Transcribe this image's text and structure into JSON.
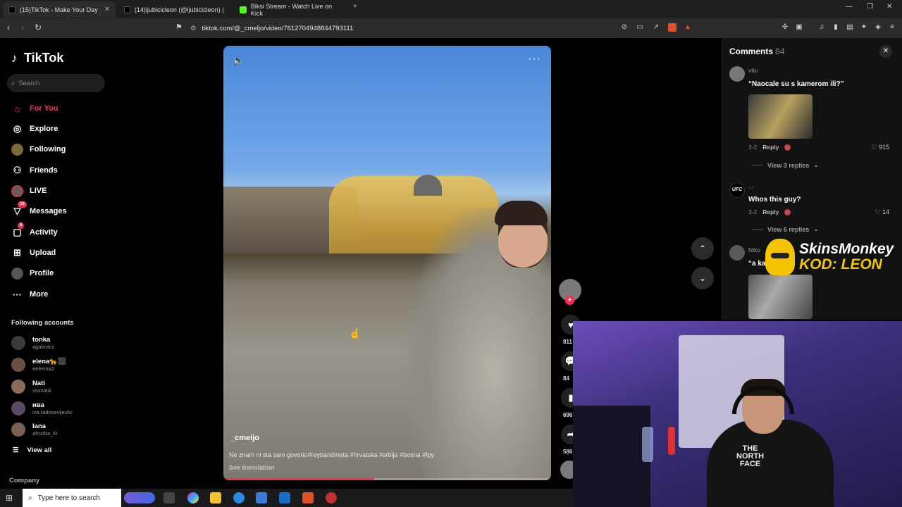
{
  "browser": {
    "tabs": [
      {
        "title": "(15)TikTok - Make Your Day",
        "active": true
      },
      {
        "title": "(14)ljubicicleon (@ljubicicleon) | TikTo",
        "active": false
      },
      {
        "title": "Biksi Stream - Watch Live on Kick",
        "active": false
      }
    ],
    "url": "tiktok.com/@_cmeljo/video/7612704948844793111"
  },
  "sidebar": {
    "logo": "TikTok",
    "search_placeholder": "Search",
    "nav": [
      {
        "label": "For You",
        "icon": "home-icon",
        "active": true
      },
      {
        "label": "Explore",
        "icon": "compass-icon"
      },
      {
        "label": "Following",
        "icon": "following-avatar-icon"
      },
      {
        "label": "Friends",
        "icon": "friends-icon"
      },
      {
        "label": "LIVE",
        "icon": "live-icon"
      },
      {
        "label": "Messages",
        "icon": "messages-icon",
        "badge": "10"
      },
      {
        "label": "Activity",
        "icon": "activity-icon",
        "badge": "5"
      },
      {
        "label": "Upload",
        "icon": "upload-icon"
      },
      {
        "label": "Profile",
        "icon": "profile-icon"
      },
      {
        "label": "More",
        "icon": "more-icon"
      }
    ],
    "following_title": "Following accounts",
    "accounts": [
      {
        "name": "tonka",
        "handle": "agalovicc"
      },
      {
        "name": "elena🐆⬛",
        "handle": "eelenna2"
      },
      {
        "name": "Nati",
        "handle": "vsxnatiii"
      },
      {
        "name": "ива",
        "handle": "iva.radosavljevlic"
      },
      {
        "name": "lana",
        "handle": "afrodita_l0"
      }
    ],
    "view_all": "View all",
    "company": "Company"
  },
  "video": {
    "author": "_cmeljo",
    "caption": "Ne znam ni sta sam govorio#reybandmeta #hrvatska #srbija #bosna #fpy",
    "see_translation": "See translation",
    "progress": 0.46,
    "likes": "811",
    "comments": "84",
    "saves": "696",
    "shares": "586"
  },
  "comments": {
    "title": "Comments",
    "count": "84",
    "items": [
      {
        "user": "vito",
        "text": "“Naocale su s kamerom ili?”",
        "date": "3-2",
        "reply": "Reply",
        "likes": "915",
        "view_replies": "View 3 replies"
      },
      {
        "user": "⸜⸝",
        "text": "Whos this guy?",
        "date": "3-2",
        "reply": "Reply",
        "likes": "14",
        "view_replies": "View 6 replies"
      },
      {
        "user": "Niko",
        "text": "“a ka...",
        "date": "",
        "reply": "",
        "likes": "",
        "view_replies": ""
      }
    ]
  },
  "overlay": {
    "brand": "SkinsMonkey",
    "code": "KOD: LEON"
  },
  "webcam": {
    "shirt_text": "THE\nNORTH\nFACE"
  },
  "taskbar": {
    "search_placeholder": "Type here to search"
  },
  "colors": {
    "accent": "#fe2c55",
    "sponsor_yellow": "#f5c400"
  }
}
